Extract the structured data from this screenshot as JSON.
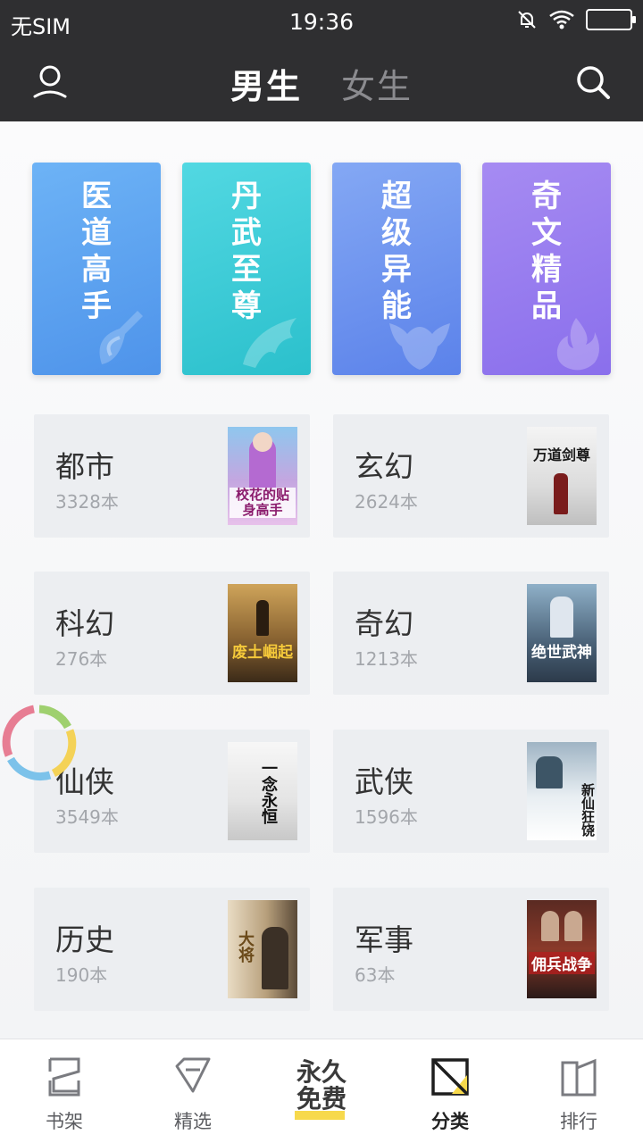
{
  "status_bar": {
    "carrier": "无SIM",
    "time": "19:36"
  },
  "header": {
    "tabs": [
      {
        "label": "男生",
        "active": true
      },
      {
        "label": "女生",
        "active": false
      }
    ],
    "user_icon": "user-icon",
    "search_icon": "search-icon"
  },
  "featured": [
    {
      "title_chars": [
        "医",
        "道",
        "高",
        "手"
      ],
      "color": "#5fa6f1",
      "icon": "sword-icon"
    },
    {
      "title_chars": [
        "丹",
        "武",
        "至",
        "尊"
      ],
      "color": "#3fd0db",
      "icon": "eagle-icon"
    },
    {
      "title_chars": [
        "超",
        "级",
        "异",
        "能"
      ],
      "color": "#6f95ee",
      "icon": "helmet-icon"
    },
    {
      "title_chars": [
        "奇",
        "文",
        "精",
        "品"
      ],
      "color": "#9a80ef",
      "icon": "flame-icon"
    }
  ],
  "categories": [
    {
      "name": "都市",
      "count": "3328本",
      "cover_title": "校花的贴身高手"
    },
    {
      "name": "玄幻",
      "count": "2624本",
      "cover_title": "万道剑尊"
    },
    {
      "name": "科幻",
      "count": "276本",
      "cover_title": "废土崛起"
    },
    {
      "name": "奇幻",
      "count": "1213本",
      "cover_title": "绝世武神"
    },
    {
      "name": "仙侠",
      "count": "3549本",
      "cover_title": "一念永恒"
    },
    {
      "name": "武侠",
      "count": "1596本",
      "cover_title": "新仙狂饶"
    },
    {
      "name": "历史",
      "count": "190本",
      "cover_title": "大将"
    },
    {
      "name": "军事",
      "count": "63本",
      "cover_title": "佣兵战争"
    }
  ],
  "bottom_nav": [
    {
      "label": "书架",
      "icon": "bookshelf-icon",
      "active": false
    },
    {
      "label": "精选",
      "icon": "featured-icon",
      "active": false
    },
    {
      "label": "永久免费",
      "icon": "promo-badge",
      "active": false
    },
    {
      "label": "分类",
      "icon": "category-icon",
      "active": true
    },
    {
      "label": "排行",
      "icon": "ranking-icon",
      "active": false
    }
  ],
  "promo": {
    "line1": "永久",
    "line2": "免费"
  }
}
